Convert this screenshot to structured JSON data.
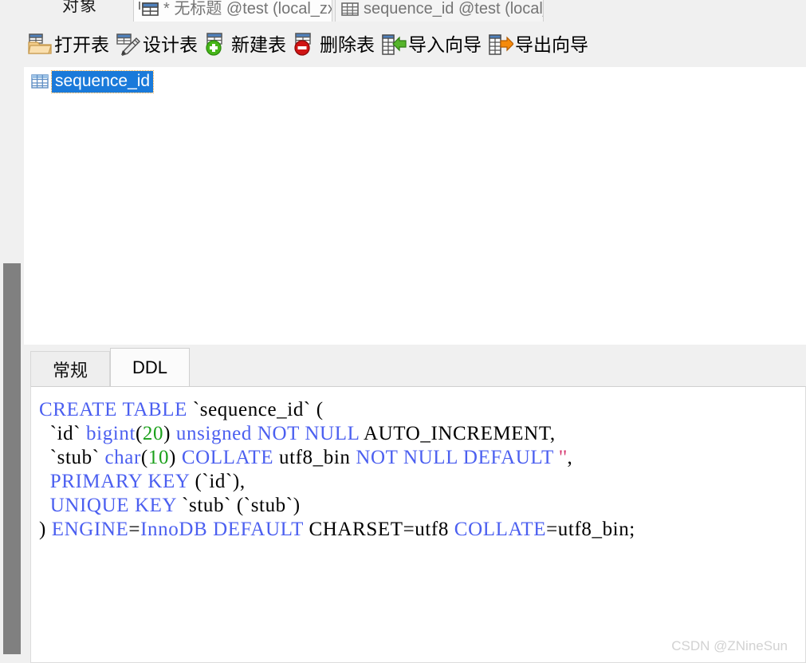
{
  "window": {
    "objects_label": "对象",
    "tabs": [
      {
        "label": "* 无标题 @test (local_zx) - ...",
        "icon": "table-grid-icon",
        "active": false,
        "modified": true
      },
      {
        "label": "sequence_id @test (local_z...",
        "icon": "table-grid-icon",
        "active": true,
        "modified": false
      }
    ]
  },
  "toolbar": {
    "buttons": [
      {
        "label": "打开表",
        "icon": "open-folder-table-icon"
      },
      {
        "label": "设计表",
        "icon": "pencil-design-table-icon"
      },
      {
        "label": "新建表",
        "icon": "plus-green-new-table-icon"
      },
      {
        "label": "删除表",
        "icon": "minus-red-delete-table-icon"
      },
      {
        "label": "导入向导",
        "icon": "import-arrow-green-icon"
      },
      {
        "label": "导出向导",
        "icon": "export-arrow-orange-icon"
      }
    ]
  },
  "object_list": {
    "items": [
      {
        "label": "sequence_id",
        "icon": "table-grid-icon",
        "selected": true
      }
    ]
  },
  "info_panel": {
    "tabs": [
      {
        "label": "常规",
        "active": false
      },
      {
        "label": "DDL",
        "active": true
      }
    ],
    "ddl": {
      "lines": [
        [
          {
            "t": "CREATE TABLE ",
            "c": "kw"
          },
          {
            "t": "`sequence_id` (",
            "c": "plain"
          }
        ],
        [
          {
            "t": "  `id` ",
            "c": "plain"
          },
          {
            "t": "bigint",
            "c": "kw"
          },
          {
            "t": "(",
            "c": "plain"
          },
          {
            "t": "20",
            "c": "num"
          },
          {
            "t": ") ",
            "c": "plain"
          },
          {
            "t": "unsigned NOT NULL ",
            "c": "kw"
          },
          {
            "t": "AUTO_INCREMENT,",
            "c": "plain"
          }
        ],
        [
          {
            "t": "  `stub` ",
            "c": "plain"
          },
          {
            "t": "char",
            "c": "kw"
          },
          {
            "t": "(",
            "c": "plain"
          },
          {
            "t": "10",
            "c": "num"
          },
          {
            "t": ") ",
            "c": "plain"
          },
          {
            "t": "COLLATE ",
            "c": "kw"
          },
          {
            "t": "utf8_bin ",
            "c": "plain"
          },
          {
            "t": "NOT NULL DEFAULT ",
            "c": "kw"
          },
          {
            "t": "''",
            "c": "str"
          },
          {
            "t": ",",
            "c": "plain"
          }
        ],
        [
          {
            "t": "  PRIMARY KEY ",
            "c": "kw"
          },
          {
            "t": "(`id`),",
            "c": "plain"
          }
        ],
        [
          {
            "t": "  UNIQUE KEY ",
            "c": "kw"
          },
          {
            "t": "`stub` (`stub`)",
            "c": "plain"
          }
        ],
        [
          {
            "t": ") ",
            "c": "plain"
          },
          {
            "t": "ENGINE",
            "c": "kw"
          },
          {
            "t": "=",
            "c": "plain"
          },
          {
            "t": "InnoDB DEFAULT ",
            "c": "kw"
          },
          {
            "t": "CHARSET=utf8 ",
            "c": "plain"
          },
          {
            "t": "COLLATE",
            "c": "kw"
          },
          {
            "t": "=utf8_bin;",
            "c": "plain"
          }
        ]
      ],
      "text": "CREATE TABLE `sequence_id` (\n  `id` bigint(20) unsigned NOT NULL AUTO_INCREMENT,\n  `stub` char(10) COLLATE utf8_bin NOT NULL DEFAULT '',\n  PRIMARY KEY (`id`),\n  UNIQUE KEY `stub` (`stub`)\n) ENGINE=InnoDB DEFAULT CHARSET=utf8 COLLATE=utf8_bin;"
    }
  },
  "watermark": {
    "text": "CSDN @ZNineSun"
  },
  "colors": {
    "selection_blue": "#1a7ada",
    "keyword_blue": "#4b5ff0",
    "number_green": "#1aa01a",
    "string_red": "#d6336c",
    "scrollbar_grey": "#808080",
    "panel_grey": "#f0f0f0"
  }
}
